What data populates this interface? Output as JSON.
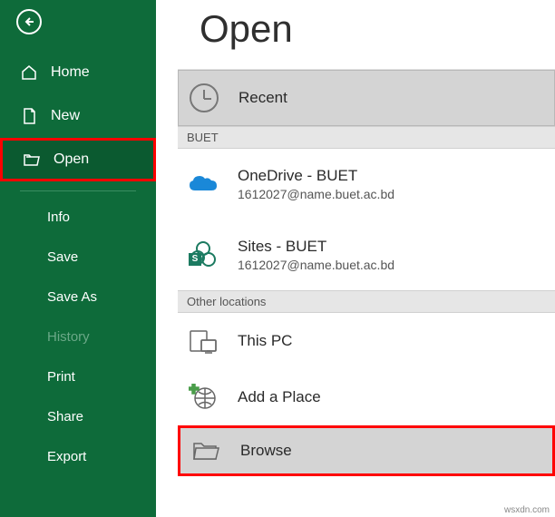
{
  "title": "Open",
  "sidebar": {
    "primary": [
      {
        "label": "Home",
        "icon": "home-icon"
      },
      {
        "label": "New",
        "icon": "new-icon"
      },
      {
        "label": "Open",
        "icon": "open-icon",
        "selected": true,
        "highlighted": true
      }
    ],
    "secondary": [
      {
        "label": "Info"
      },
      {
        "label": "Save"
      },
      {
        "label": "Save As"
      },
      {
        "label": "History",
        "disabled": true
      },
      {
        "label": "Print"
      },
      {
        "label": "Share"
      },
      {
        "label": "Export"
      }
    ]
  },
  "locations": {
    "recent": {
      "label": "Recent",
      "selected": true
    },
    "sections": [
      {
        "header": "BUET",
        "items": [
          {
            "title": "OneDrive - BUET",
            "subtitle": "1612027@name.buet.ac.bd",
            "icon": "onedrive-icon"
          },
          {
            "title": "Sites - BUET",
            "subtitle": "1612027@name.buet.ac.bd",
            "icon": "sharepoint-icon"
          }
        ]
      },
      {
        "header": "Other locations",
        "items": [
          {
            "title": "This PC",
            "icon": "thispc-icon"
          },
          {
            "title": "Add a Place",
            "icon": "addplace-icon"
          },
          {
            "title": "Browse",
            "icon": "browse-icon",
            "highlighted": true
          }
        ]
      }
    ]
  },
  "watermark": "wsxdn.com"
}
